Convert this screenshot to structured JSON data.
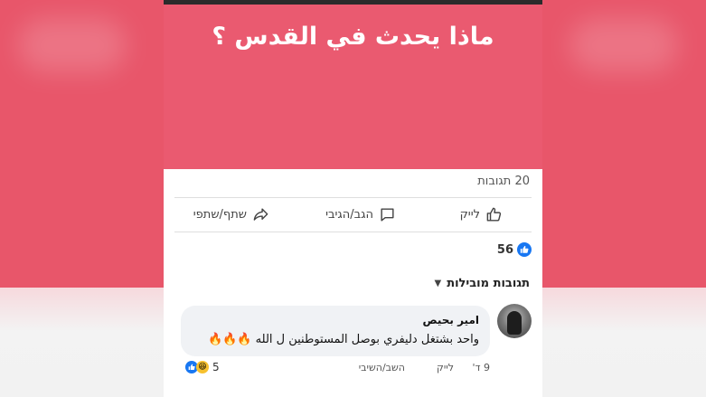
{
  "post": {
    "title": "ماذا يحدث في القدس ؟",
    "comment_count": "20 תגובות"
  },
  "actions": {
    "like": "לייק",
    "comment": "הגב/הגיבי",
    "share": "שתף/שתפי"
  },
  "reactions": {
    "count": "56"
  },
  "comments_section": {
    "sort_label": "תגובות מובילות"
  },
  "comment": {
    "author": "امير بحيص",
    "text": "واحد بشتغل دليفري بوصل المستوطنين ل الله 🔥🔥🔥",
    "time": "9 ד'",
    "like_action": "לייק",
    "reply_action": "השב/השיבי",
    "reaction_count": "5"
  },
  "colors": {
    "banner": "#ea5a70",
    "like_blue": "#1877f2"
  }
}
